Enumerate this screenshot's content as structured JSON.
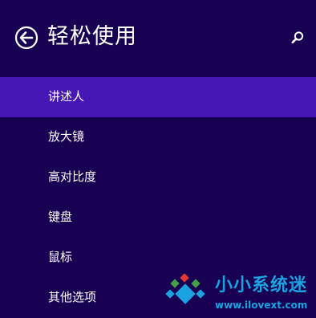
{
  "header": {
    "title": "轻松使用",
    "back_icon": "back-arrow-circle-icon",
    "search_icon": "search-icon"
  },
  "menu": {
    "items": [
      {
        "label": "讲述人",
        "selected": true
      },
      {
        "label": "放大镜",
        "selected": false
      },
      {
        "label": "高对比度",
        "selected": false
      },
      {
        "label": "键盘",
        "selected": false
      },
      {
        "label": "鼠标",
        "selected": false
      },
      {
        "label": "其他选项",
        "selected": false
      }
    ]
  },
  "watermark": {
    "title": "小小系统迷",
    "url": "www.ilovext.com"
  },
  "colors": {
    "background": "#180052",
    "selected": "#4617b4",
    "text": "#ffffff",
    "watermark": "#1aa3e0"
  }
}
